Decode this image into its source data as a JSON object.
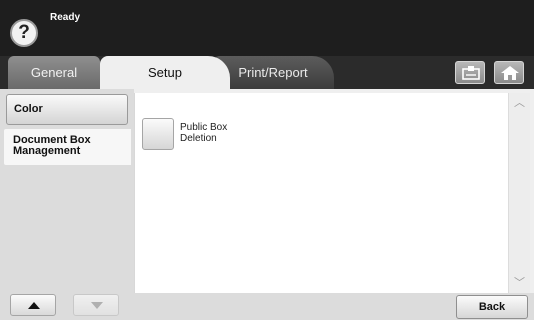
{
  "status": {
    "text": "Ready",
    "help_icon": "question-mark-icon",
    "help_glyph": "?"
  },
  "tabs": [
    {
      "label": "General",
      "active": false
    },
    {
      "label": "Setup",
      "active": true
    },
    {
      "label": "Print/Report",
      "active": false
    }
  ],
  "toolbar": {
    "counter_icon": "counter-icon",
    "home_icon": "home-icon"
  },
  "left_nav": {
    "items": [
      {
        "label": "Color",
        "selected": false
      },
      {
        "label": "Document Box\nManagement",
        "selected": true
      }
    ],
    "up_icon": "arrow-up-icon",
    "down_icon": "arrow-down-icon"
  },
  "main": {
    "options": [
      {
        "label": "Public Box\nDeletion"
      }
    ]
  },
  "scrollbar": {
    "up_glyph": "︿",
    "down_glyph": "﹀"
  },
  "bottom": {
    "back_label": "Back"
  }
}
